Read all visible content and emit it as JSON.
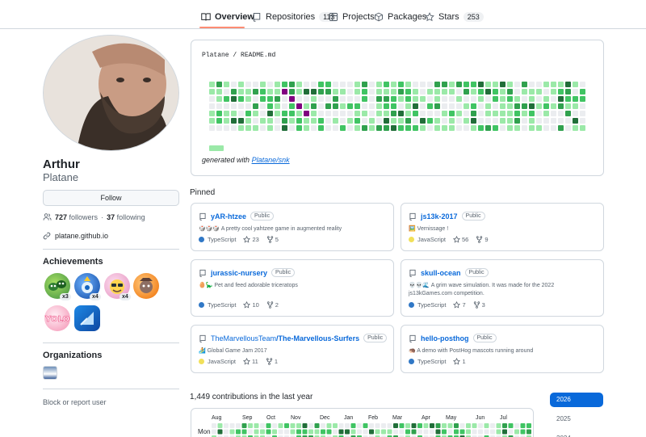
{
  "nav": {
    "tabs": [
      {
        "label": "Overview",
        "icon": "book-icon"
      },
      {
        "label": "Repositories",
        "icon": "repo-icon",
        "count": "113"
      },
      {
        "label": "Projects",
        "icon": "table-icon"
      },
      {
        "label": "Packages",
        "icon": "package-icon"
      },
      {
        "label": "Stars",
        "icon": "star-icon",
        "count": "253"
      }
    ]
  },
  "profile": {
    "name": "Arthur",
    "login": "Platane",
    "follow_label": "Follow",
    "followers": "727",
    "followers_label": "followers",
    "dot": "·",
    "following": "37",
    "following_label": "following",
    "website": "platane.github.io"
  },
  "achievements": {
    "title": "Achievements",
    "badges": [
      {
        "name": "pair-extraordinaire",
        "count": "x3",
        "color": "#4caf50"
      },
      {
        "name": "quickdraw",
        "count": "x4",
        "color": "#1e6fd9"
      },
      {
        "name": "pull-shark",
        "count": "x4",
        "color": "#e6a1c3"
      },
      {
        "name": "starstruck",
        "count": "",
        "color": "#f0a04b"
      },
      {
        "name": "yolo",
        "count": "",
        "color": "#f4a3c7"
      },
      {
        "name": "arctic-code-vault",
        "count": "",
        "color": "#1565c0"
      }
    ]
  },
  "organizations": {
    "title": "Organizations"
  },
  "block_label": "Block or report user",
  "readme": {
    "owner": "Platane",
    "slash": "/",
    "file": "README.md",
    "generated_prefix": "generated with",
    "generated_link": "Platane/snk"
  },
  "pinned": {
    "title": "Pinned",
    "public_label": "Public",
    "cards": [
      {
        "owner": "",
        "repo": "yAR-htzee",
        "desc": "🎲🎲🎲 A pretty cool yahtzee game in augmented reality",
        "lang": "TypeScript",
        "lang_color": "#3178c6",
        "stars": "23",
        "forks": "5"
      },
      {
        "owner": "",
        "repo": "js13k-2017",
        "desc": "🖼️ Vernissage !",
        "lang": "JavaScript",
        "lang_color": "#f1e05a",
        "stars": "56",
        "forks": "9"
      },
      {
        "owner": "",
        "repo": "jurassic-nursery",
        "desc": "🥚🦕 Pet and feed adorable triceratops",
        "lang": "TypeScript",
        "lang_color": "#3178c6",
        "stars": "10",
        "forks": "2"
      },
      {
        "owner": "",
        "repo": "skull-ocean",
        "desc": "💀💀🌊 A grim wave simulation. It was made for the 2022 js13kGames.com competition.",
        "lang": "TypeScript",
        "lang_color": "#3178c6",
        "stars": "7",
        "forks": "3"
      },
      {
        "owner": "TheMarvellousTeam",
        "repo": "The-Marvellous-Surfers",
        "desc": "🏄 Global Game Jam 2017",
        "lang": "JavaScript",
        "lang_color": "#f1e05a",
        "stars": "11",
        "forks": "1"
      },
      {
        "owner": "",
        "repo": "hello-posthog",
        "desc": "🦔 A demo with PostHog mascots running around",
        "lang": "TypeScript",
        "lang_color": "#3178c6",
        "stars": "1",
        "forks": ""
      }
    ]
  },
  "contributions": {
    "title": "1,449 contributions in the last year",
    "months": [
      "Aug",
      "Sep",
      "Oct",
      "Nov",
      "Dec",
      "Jan",
      "Feb",
      "Mar",
      "Apr",
      "May",
      "Jun",
      "Jul"
    ],
    "weekday": "Mon",
    "years": [
      "2026",
      "2025",
      "2024"
    ]
  },
  "colors": {
    "accent": "#0969da",
    "tab_underline": "#fd8c73",
    "snake": "#800080",
    "green_levels": [
      "#ebedf0",
      "#9be9a8",
      "#40c463",
      "#30a14e",
      "#216e39"
    ]
  }
}
